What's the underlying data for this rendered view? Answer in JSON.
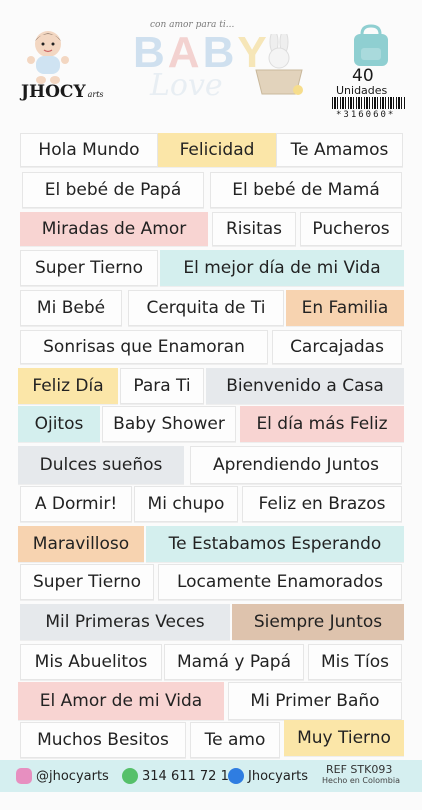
{
  "header": {
    "tagline": "con amor para ti...",
    "title_letters": [
      "B",
      "A",
      "B",
      "Y"
    ],
    "title_script": "Love",
    "brand": "JHOCY",
    "brand_sub": "arts",
    "count": "40",
    "units": "Unidades",
    "barcode_number": "*316060*"
  },
  "stickers": [
    {
      "text": "Hola Mundo",
      "color": "white"
    },
    {
      "text": "Felicidad",
      "color": "yellow"
    },
    {
      "text": "Te Amamos",
      "color": "white"
    },
    {
      "text": "El bebé de Papá",
      "color": "white"
    },
    {
      "text": "El bebé de Mamá",
      "color": "white"
    },
    {
      "text": "Miradas de Amor",
      "color": "pink"
    },
    {
      "text": "Risitas",
      "color": "white"
    },
    {
      "text": "Pucheros",
      "color": "white"
    },
    {
      "text": "Super Tierno",
      "color": "white"
    },
    {
      "text": "El mejor día de mi Vida",
      "color": "mint"
    },
    {
      "text": "Mi Bebé",
      "color": "white"
    },
    {
      "text": "Cerquita de Ti",
      "color": "white"
    },
    {
      "text": "En Familia",
      "color": "peach"
    },
    {
      "text": "Sonrisas que Enamoran",
      "color": "white"
    },
    {
      "text": "Carcajadas",
      "color": "white"
    },
    {
      "text": "Feliz Día",
      "color": "yellow"
    },
    {
      "text": "Para Ti",
      "color": "white"
    },
    {
      "text": "Bienvenido a Casa",
      "color": "gray"
    },
    {
      "text": "Ojitos",
      "color": "mint"
    },
    {
      "text": "Baby Shower",
      "color": "white"
    },
    {
      "text": "El día más Feliz",
      "color": "pink"
    },
    {
      "text": "Dulces sueños",
      "color": "gray"
    },
    {
      "text": "Aprendiendo Juntos",
      "color": "white"
    },
    {
      "text": "A Dormir!",
      "color": "white"
    },
    {
      "text": "Mi chupo",
      "color": "white"
    },
    {
      "text": "Feliz en Brazos",
      "color": "white"
    },
    {
      "text": "Maravilloso",
      "color": "peach"
    },
    {
      "text": "Te Estabamos Esperando",
      "color": "mint"
    },
    {
      "text": "Super Tierno",
      "color": "white"
    },
    {
      "text": "Locamente Enamorados",
      "color": "white"
    },
    {
      "text": "Mil Primeras Veces",
      "color": "gray"
    },
    {
      "text": "Siempre Juntos",
      "color": "tan"
    },
    {
      "text": "Mis Abuelitos",
      "color": "white"
    },
    {
      "text": "Mamá y Papá",
      "color": "white"
    },
    {
      "text": "Mis Tíos",
      "color": "white"
    },
    {
      "text": "El Amor de mi Vida",
      "color": "pink"
    },
    {
      "text": "Mi Primer Baño",
      "color": "white"
    },
    {
      "text": "Muchos Besitos",
      "color": "white"
    },
    {
      "text": "Te amo",
      "color": "white"
    },
    {
      "text": "Muy Tierno",
      "color": "yellow"
    }
  ],
  "footer": {
    "instagram": "@jhocyarts",
    "whatsapp": "314 611 72 19",
    "facebook": "Jhocyarts",
    "ref": "REF  STK093",
    "made_in": "Hecho en Colombia"
  },
  "colors": {
    "yellow": "#fbe6a8",
    "pink": "#f8d4d2",
    "mint": "#d4efee",
    "peach": "#f7d3b0",
    "gray": "#e6e9ec",
    "tan": "#dec3ad",
    "footer": "#d5eff0"
  }
}
